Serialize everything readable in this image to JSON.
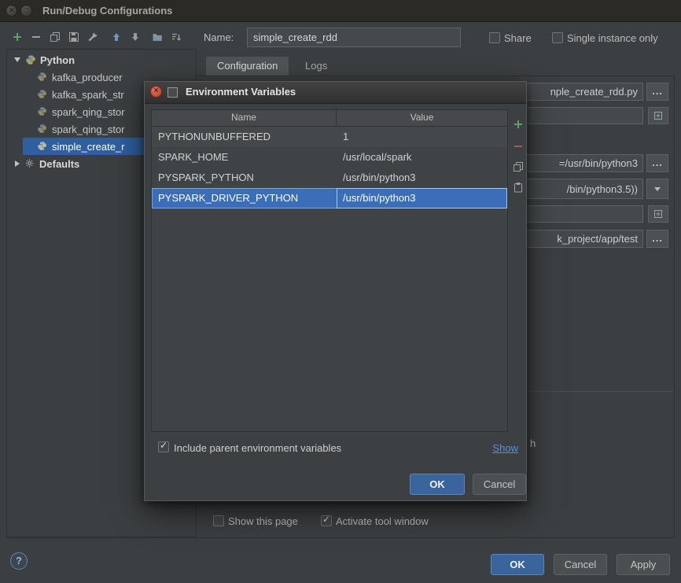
{
  "window": {
    "title": "Run/Debug Configurations"
  },
  "toolbar": {
    "name_label": "Name:",
    "name_value": "simple_create_rdd",
    "share_label": "Share",
    "share_checked": false,
    "single_instance_label": "Single instance only",
    "single_instance_checked": false
  },
  "tree": {
    "root_label": "Python",
    "items": [
      "kafka_producer",
      "kafka_spark_str",
      "spark_qing_stor",
      "spark_qing_stor",
      "simple_create_r"
    ],
    "selected_index": 4,
    "defaults_label": "Defaults"
  },
  "tabs": {
    "configuration": "Configuration",
    "logs": "Logs"
  },
  "fields": {
    "browse_label": "...",
    "script_value": "nple_create_rdd.py",
    "interpreter_options_value": "=/usr/bin/python3",
    "interpreter_value": "/bin/python3.5))",
    "working_directory_value": "k_project/app/test",
    "clipped_label": "h"
  },
  "dialog": {
    "title": "Environment Variables",
    "columns": {
      "name": "Name",
      "value": "Value"
    },
    "rows": [
      {
        "name": "PYTHONUNBUFFERED",
        "value": "1",
        "selected": false
      },
      {
        "name": "SPARK_HOME",
        "value": "/usr/local/spark",
        "selected": false
      },
      {
        "name": "PYSPARK_PYTHON",
        "value": "/usr/bin/python3",
        "selected": false
      },
      {
        "name": "PYSPARK_DRIVER_PYTHON",
        "value": "/usr/bin/python3",
        "selected": true
      }
    ],
    "include_parent_label": "Include parent environment variables",
    "include_parent_checked": true,
    "show_link_label": "Show",
    "ok_label": "OK",
    "cancel_label": "Cancel"
  },
  "footer": {
    "show_this_page_label": "Show this page",
    "show_this_page_checked": false,
    "activate_tool_window_label": "Activate tool window",
    "activate_tool_window_checked": true,
    "help_label": "?",
    "ok_label": "OK",
    "cancel_label": "Cancel",
    "apply_label": "Apply"
  },
  "colors": {
    "panel_bg": "#3c3f41",
    "selection_blue": "#2e5f9e",
    "table_selection_blue": "#3b6eb8",
    "button_blue": "#3a659c",
    "link_blue": "#5691d8",
    "add_green": "#5fad5f",
    "remove_red": "#c75450"
  }
}
